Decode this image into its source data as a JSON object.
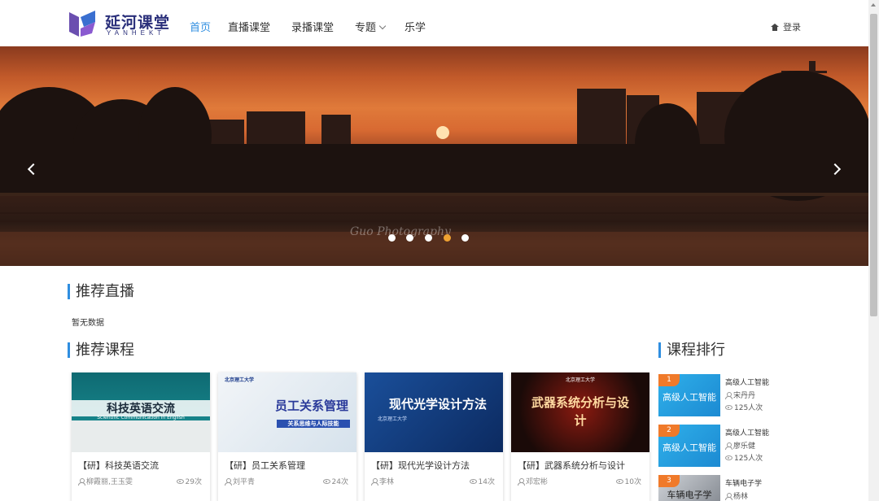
{
  "header": {
    "logo_cn": "延河课堂",
    "logo_en": "YANHEKT",
    "nav": [
      {
        "label": "首页"
      },
      {
        "label": "直播课堂"
      },
      {
        "label": "录播课堂"
      },
      {
        "label": "专题"
      },
      {
        "label": "乐学"
      }
    ],
    "login_label": "登录"
  },
  "banner": {
    "watermark": "Guo Photography",
    "slide_count": 5,
    "active_slide": 4
  },
  "live": {
    "title": "推荐直播",
    "empty_text": "暂无数据"
  },
  "courses": {
    "title": "推荐课程",
    "items": [
      {
        "cover": "科技英语交流",
        "cover_sub": "Scientific Communication in English",
        "title": "【研】科技英语交流",
        "teachers": "柳霞丽,王玉雯",
        "views": "29次"
      },
      {
        "cover": "员工关系管理",
        "cover_sub": "关系思维与人际技能",
        "cover_top": "北京理工大学",
        "title": "【研】员工关系管理",
        "teachers": "刘平青",
        "views": "24次"
      },
      {
        "cover": "现代光学设计方法",
        "cover_top": "北京理工大学",
        "title": "【研】现代光学设计方法",
        "teachers": "李林",
        "views": "14次"
      },
      {
        "cover": "武器系统分析与设计",
        "cover_top": "北京理工大学",
        "title": "【研】武器系统分析与设计",
        "teachers": "邓宏彬",
        "views": "10次"
      }
    ]
  },
  "ranking": {
    "title": "课程排行",
    "items": [
      {
        "rank": "1",
        "thumb": "高级人工智能",
        "name": "高级人工智能",
        "teacher": "宋丹丹",
        "views": "125人次"
      },
      {
        "rank": "2",
        "thumb": "高级人工智能",
        "name": "高级人工智能",
        "teacher": "廖乐健",
        "views": "125人次"
      },
      {
        "rank": "3",
        "thumb": "车辆电子学",
        "name": "车辆电子学",
        "teacher": "杨林",
        "views": ""
      }
    ]
  },
  "colors": {
    "accent": "#2f8ee0",
    "rank_badge": "#f07a2a",
    "dot_active": "#f0a232"
  }
}
